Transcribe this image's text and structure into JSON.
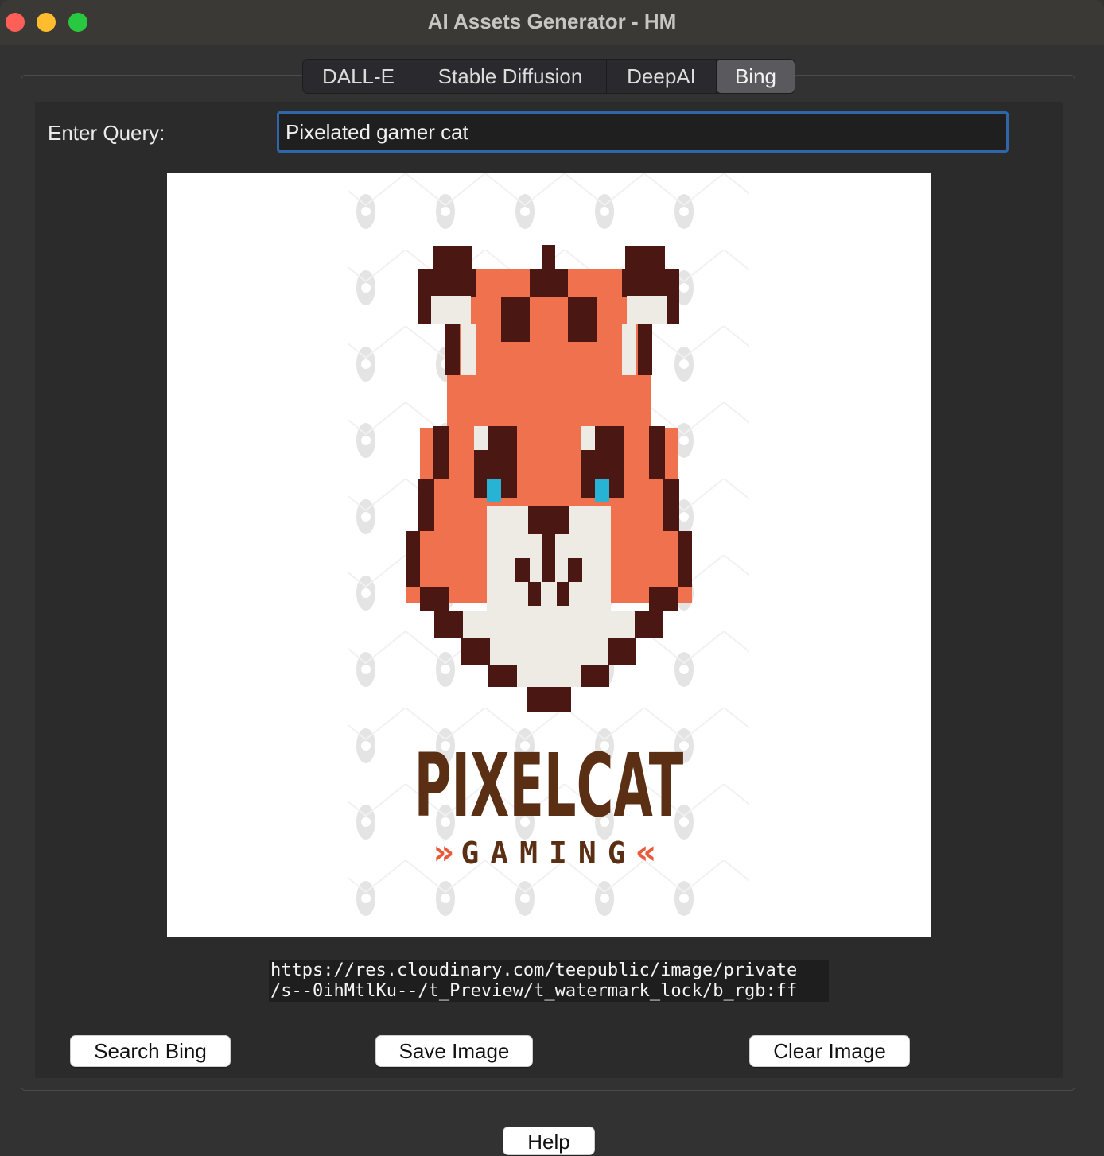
{
  "window": {
    "title": "AI Assets Generator - HM"
  },
  "tabs": [
    {
      "label": "DALL-E",
      "active": false
    },
    {
      "label": "Stable Diffusion",
      "active": false
    },
    {
      "label": "DeepAI",
      "active": false
    },
    {
      "label": "Bing",
      "active": true
    }
  ],
  "query": {
    "label": "Enter Query:",
    "value": "Pixelated gamer cat"
  },
  "image": {
    "logo_title": "PIXELCAT",
    "logo_subtitle": "GAMING",
    "logo_left_mark": "»",
    "logo_right_mark": "«"
  },
  "result_url": {
    "line1": "https://res.cloudinary.com/teepublic/image/private",
    "line2": "/s--0ihMtlKu--/t_Preview/t_watermark_lock/b_rgb:ff"
  },
  "buttons": {
    "search": "Search Bing",
    "save": "Save Image",
    "clear": "Clear Image",
    "help": "Help"
  },
  "colors": {
    "accent_focus": "#2f66a8",
    "cat_orange": "#f0714e",
    "cat_dark": "#4a1712",
    "cat_cream": "#eeeae4",
    "cat_eye": "#27b3d4",
    "logo_brown": "#5a2f14",
    "logo_red": "#e85a3a"
  }
}
